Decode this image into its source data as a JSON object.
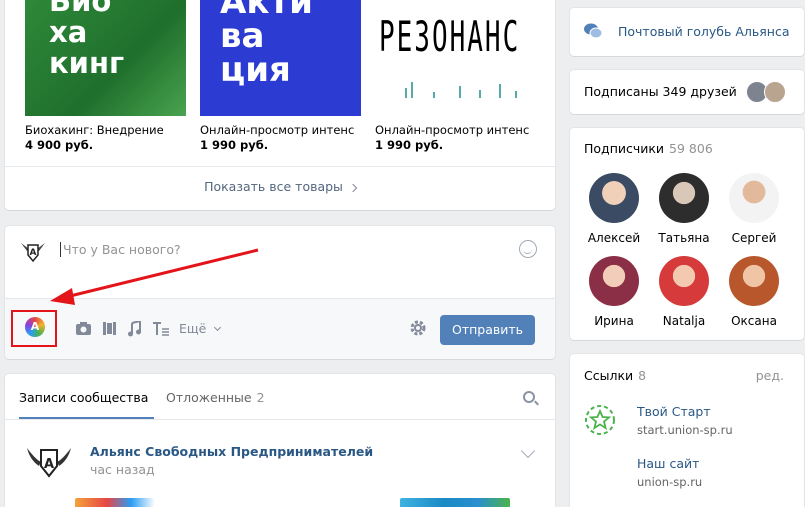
{
  "products": {
    "items": [
      {
        "image_text": [
          "Био",
          "ха",
          "кинг"
        ],
        "title": "Биохакинг: Внедрение",
        "price": "4 900 руб."
      },
      {
        "image_text": [
          "Акти",
          "ва",
          "ция"
        ],
        "title": "Онлайн-просмотр интенс",
        "price": "1 990 руб."
      },
      {
        "image_text": [
          "РЕЗОНАНС"
        ],
        "title": "Онлайн-просмотр интенс",
        "price": "1 990 руб."
      }
    ],
    "show_all": "Показать все товары"
  },
  "composer": {
    "placeholder": "Что у Вас нового?",
    "more": "Ещё",
    "send": "Отправить",
    "app_icon_letter": "A"
  },
  "wall": {
    "tab_posts": "Записи сообщества",
    "tab_postponed": "Отложенные",
    "tab_postponed_count": "2",
    "post": {
      "author": "Альянс Свободных Предпринимателей",
      "time": "час назад"
    }
  },
  "sidebar": {
    "mail": "Почтовый голубь Альянса",
    "friends_subscribed": "Подписаны 349 друзей",
    "followers": {
      "title": "Подписчики",
      "count": "59 806",
      "people": [
        {
          "name": "Алексей",
          "color": "#9aa5b4"
        },
        {
          "name": "Татьяна",
          "color": "#5a5a5a"
        },
        {
          "name": "Сергей",
          "color": "#c9b8a6"
        },
        {
          "name": "Ирина",
          "color": "#b25470"
        },
        {
          "name": "Natalja",
          "color": "#d64a4a"
        },
        {
          "name": "Оксана",
          "color": "#c76b3d"
        }
      ]
    },
    "links": {
      "title": "Ссылки",
      "count": "8",
      "edit": "ред.",
      "items": [
        {
          "title": "Твой Старт",
          "url": "start.union-sp.ru"
        },
        {
          "title": "Наш сайт",
          "url": "union-sp.ru"
        }
      ]
    }
  },
  "colors": {
    "accent": "#5181b8",
    "link": "#2a5885",
    "annotation": "#e3151a"
  }
}
